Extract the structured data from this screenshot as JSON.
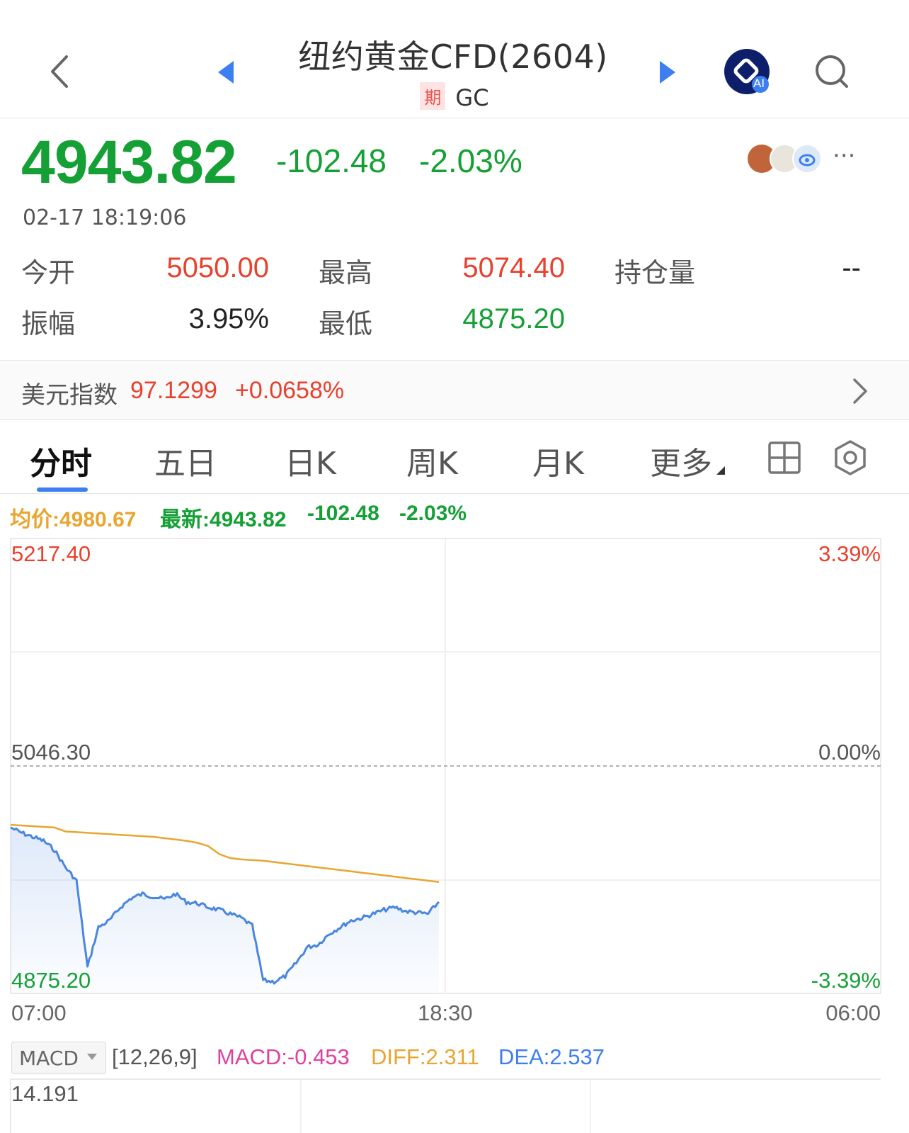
{
  "header": {
    "title": "纽约黄金CFD(2604)",
    "badge": "期",
    "code": "GC",
    "ai_label": "AI"
  },
  "quote": {
    "price": "4943.82",
    "change": "-102.48",
    "change_pct": "-2.03%",
    "timestamp": "02-17 18:19:06",
    "more": "···"
  },
  "stats": {
    "open_label": "今开",
    "open_value": "5050.00",
    "high_label": "最高",
    "high_value": "5074.40",
    "oi_label": "持仓量",
    "oi_value": "--",
    "amp_label": "振幅",
    "amp_value": "3.95%",
    "low_label": "最低",
    "low_value": "4875.20"
  },
  "dxy": {
    "label": "美元指数",
    "value": "97.1299",
    "change": "+0.0658%"
  },
  "tabs": [
    "分时",
    "五日",
    "日K",
    "周K",
    "月K",
    "更多"
  ],
  "legend": {
    "avg": "均价:4980.67",
    "latest": "最新:4943.82",
    "change": "-102.48",
    "pct": "-2.03%"
  },
  "chart_axis": {
    "y_top": "5217.40",
    "y_mid": "5046.30",
    "y_bot": "4875.20",
    "pct_top": "3.39%",
    "pct_mid": "0.00%",
    "pct_bot": "-3.39%",
    "x_start": "07:00",
    "x_mid": "18:30",
    "x_end": "06:00"
  },
  "macd": {
    "selector": "MACD",
    "params": "[12,26,9]",
    "macd": "MACD:-0.453",
    "diff": "DIFF:2.311",
    "dea": "DEA:2.537",
    "y_top": "14.191"
  },
  "colors": {
    "up": "#e8412e",
    "down": "#15a035",
    "price_line": "#4a86e0",
    "avg_line": "#e8a530",
    "accent": "#3d7ff0",
    "macd": "#e040a0",
    "diff": "#e8a530",
    "dea": "#3d7ff0"
  },
  "chart_data": {
    "type": "line",
    "x_ticks": [
      "07:00",
      "18:30",
      "06:00"
    ],
    "ylim": [
      4875.2,
      5217.4
    ],
    "y_ref": 5046.3,
    "series": [
      {
        "name": "最新",
        "values": [
          5000,
          4996,
          4993,
          4990,
          4983,
          4970,
          4960,
          4895,
          4925,
          4930,
          4940,
          4947,
          4950,
          4948,
          4946,
          4950,
          4944,
          4943,
          4940,
          4938,
          4935,
          4932,
          4926,
          4885,
          4884,
          4888,
          4898,
          4910,
          4912,
          4920,
          4925,
          4930,
          4932,
          4935,
          4938,
          4940,
          4937,
          4936,
          4935,
          4944
        ]
      },
      {
        "name": "均价",
        "values": [
          5002,
          5001.5,
          5001,
          5000.5,
          5000,
          4997,
          4996.5,
          4996,
          4995.5,
          4995,
          4994.5,
          4994,
          4993.5,
          4993,
          4992,
          4991,
          4990,
          4988.5,
          4986,
          4980,
          4977,
          4976,
          4975.5,
          4975,
          4974,
          4973,
          4972,
          4971,
          4970,
          4969,
          4968,
          4967,
          4966,
          4965,
          4964,
          4963,
          4962,
          4961,
          4960,
          4959
        ]
      }
    ]
  }
}
